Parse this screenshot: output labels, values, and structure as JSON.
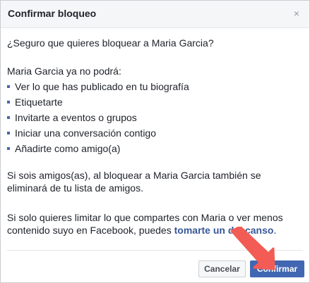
{
  "dialog": {
    "title": "Confirmar bloqueo",
    "close_glyph": "×",
    "question": "¿Seguro que quieres bloquear a Maria Garcia?",
    "will_not_text": "Maria Garcia ya no podrá:",
    "restrictions": [
      "Ver lo que has publicado en tu biografía",
      "Etiquetarte",
      "Invitarte a eventos o grupos",
      "Iniciar una conversación contigo",
      "Añadirte como amigo(a)"
    ],
    "friends_note": "Si sois amigos(as), al bloquear a Maria Garcia también se eliminará de tu lista de amigos.",
    "limit_note_prefix": "Si solo quieres limitar lo que compartes con Maria o ver menos contenido suyo en Facebook, puedes ",
    "limit_note_link": "tomarte un descanso",
    "limit_note_suffix": ".",
    "cancel_label": "Cancelar",
    "confirm_label": "Confirmar"
  },
  "colors": {
    "accent": "#4267b2",
    "link": "#365899",
    "arrow": "#f25c54"
  },
  "icons": {
    "close": "close-icon",
    "annotation": "red-arrow-icon"
  }
}
